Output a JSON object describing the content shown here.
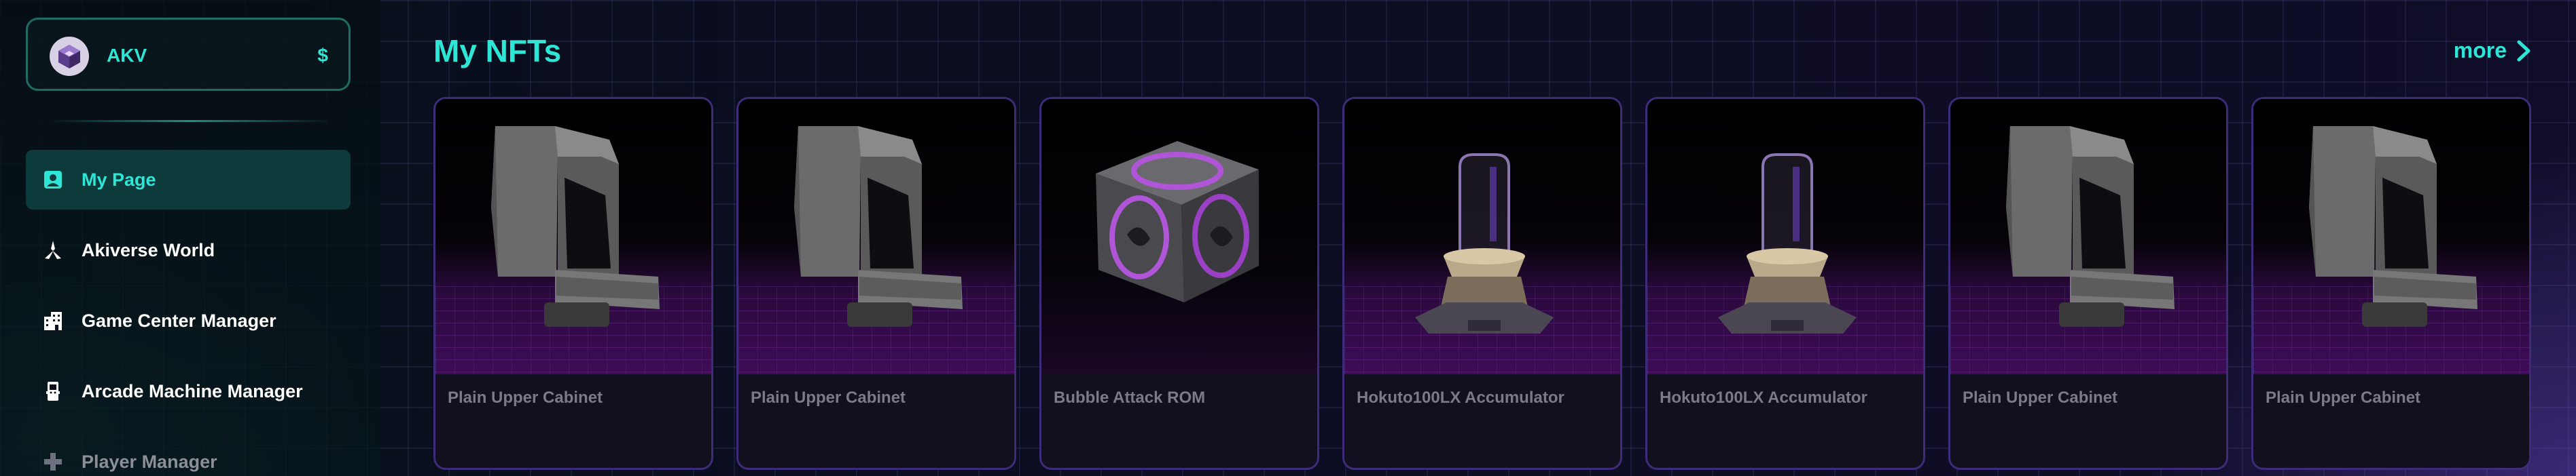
{
  "account": {
    "name": "AKV",
    "currency_symbol": "$"
  },
  "nav": {
    "items": [
      {
        "label": "My Page",
        "icon": "profile-card-icon",
        "active": true
      },
      {
        "label": "Akiverse World",
        "icon": "tri-blade-icon"
      },
      {
        "label": "Game Center Manager",
        "icon": "building-icon"
      },
      {
        "label": "Arcade Machine Manager",
        "icon": "arcade-machine-icon"
      },
      {
        "label": "Player Manager",
        "icon": "gamepad-cross-icon"
      }
    ]
  },
  "main": {
    "title": "My NFTs",
    "more_label": "more",
    "nfts": [
      {
        "name": "Plain Upper Cabinet",
        "image": "cabinet"
      },
      {
        "name": "Plain Upper Cabinet",
        "image": "cabinet"
      },
      {
        "name": "Bubble Attack ROM",
        "image": "rom-cube"
      },
      {
        "name": "Hokuto100LX Accumulator",
        "image": "accumulator"
      },
      {
        "name": "Hokuto100LX Accumulator",
        "image": "accumulator"
      },
      {
        "name": "Plain Upper Cabinet",
        "image": "cabinet"
      },
      {
        "name": "Plain Upper Cabinet",
        "image": "cabinet"
      }
    ]
  },
  "colors": {
    "accent": "#2ee6d6",
    "card_border": "#3e2c7a",
    "active_nav_bg": "#0d3a3a"
  }
}
